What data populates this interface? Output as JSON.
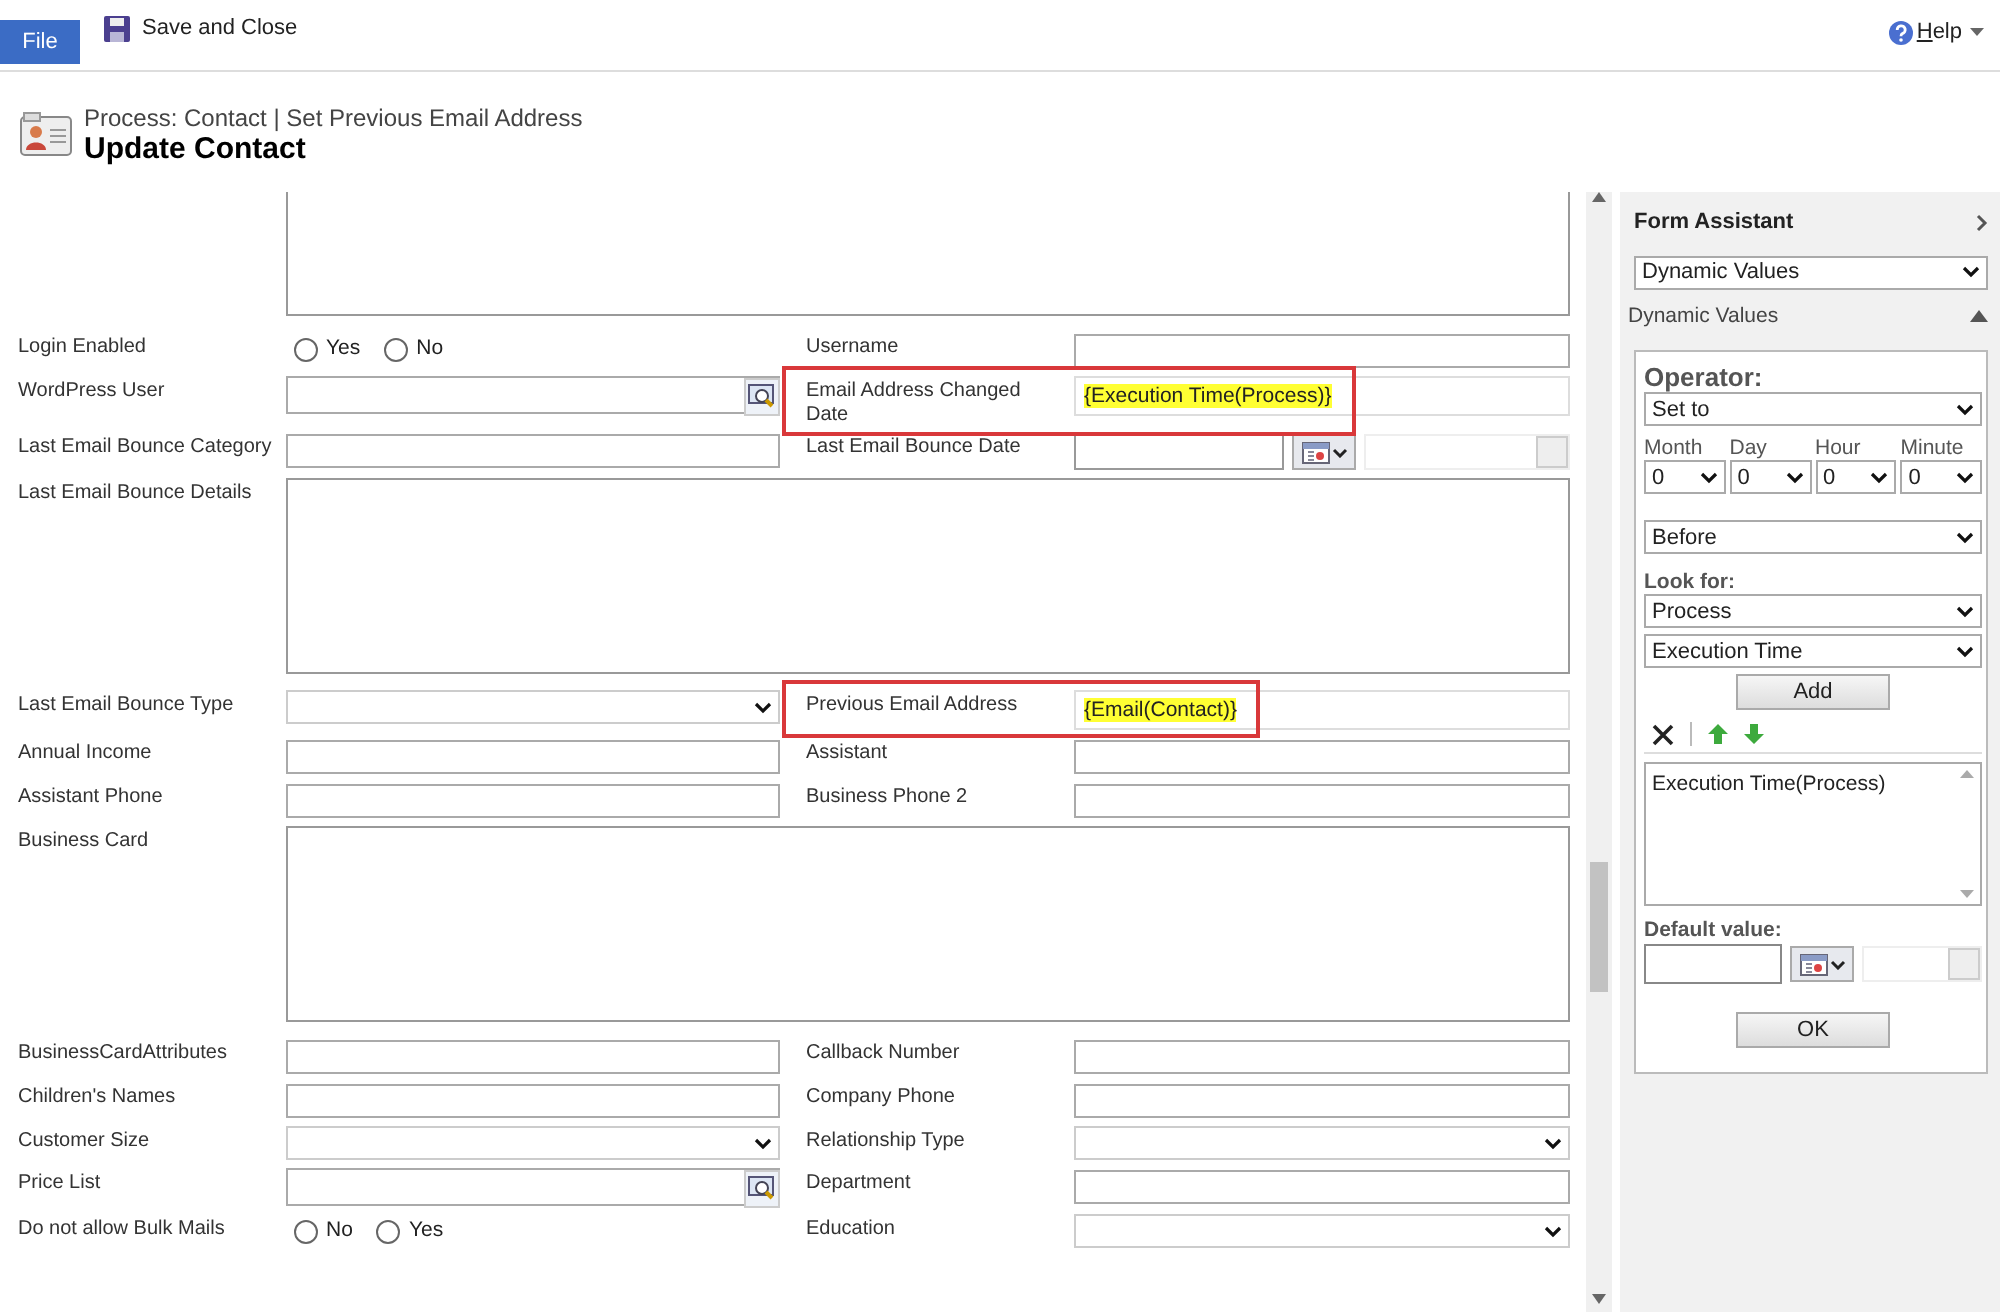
{
  "ribbon": {
    "file_tab": "File",
    "save_button": "Save and Close",
    "help": "Help"
  },
  "header": {
    "breadcrumb": "Process: Contact | Set Previous Email Address",
    "title": "Update Contact"
  },
  "form": {
    "rows": [
      {
        "kind": "textarea",
        "cut_top": true
      },
      {
        "kind": "pair",
        "left": {
          "label": "Login Enabled",
          "kind": "radio",
          "options": [
            {
              "label": "Yes",
              "selected": false
            },
            {
              "label": "No",
              "selected": false
            }
          ]
        },
        "right": {
          "label": "Username",
          "kind": "text"
        }
      },
      {
        "kind": "pair",
        "left": {
          "label": "WordPress User",
          "kind": "lookup"
        },
        "right": {
          "label": "Email Address Changed Date",
          "kind": "dynamic",
          "value": "{Execution Time(Process)}",
          "highlighted": true
        }
      },
      {
        "kind": "pair",
        "left": {
          "label": "Last Email Bounce Category",
          "kind": "text"
        },
        "right": {
          "label": "Last Email Bounce Date",
          "kind": "date"
        }
      },
      {
        "kind": "textarea",
        "label": "Last Email Bounce Details"
      },
      {
        "kind": "pair",
        "left": {
          "label": "Last Email Bounce Type",
          "kind": "select"
        },
        "right": {
          "label": "Previous Email Address",
          "kind": "dynamic",
          "value": "{Email(Contact)}",
          "highlighted": true
        }
      },
      {
        "kind": "pair",
        "left": {
          "label": "Annual Income",
          "kind": "text"
        },
        "right": {
          "label": "Assistant",
          "kind": "text"
        }
      },
      {
        "kind": "pair",
        "left": {
          "label": "Assistant Phone",
          "kind": "text"
        },
        "right": {
          "label": "Business Phone 2",
          "kind": "text"
        }
      },
      {
        "kind": "textarea",
        "label": "Business Card"
      },
      {
        "kind": "pair",
        "left": {
          "label": "BusinessCardAttributes",
          "kind": "text"
        },
        "right": {
          "label": "Callback Number",
          "kind": "text"
        }
      },
      {
        "kind": "pair",
        "left": {
          "label": "Children's Names",
          "kind": "text"
        },
        "right": {
          "label": "Company Phone",
          "kind": "text"
        }
      },
      {
        "kind": "pair",
        "left": {
          "label": "Customer Size",
          "kind": "select"
        },
        "right": {
          "label": "Relationship Type",
          "kind": "select"
        }
      },
      {
        "kind": "pair",
        "left": {
          "label": "Price List",
          "kind": "lookup"
        },
        "right": {
          "label": "Department",
          "kind": "text"
        }
      },
      {
        "kind": "pair",
        "left": {
          "label": "Do not allow Bulk Mails",
          "kind": "radio",
          "options": [
            {
              "label": "No",
              "selected": false
            },
            {
              "label": "Yes",
              "selected": false
            }
          ]
        },
        "right": {
          "label": "Education",
          "kind": "select"
        }
      }
    ]
  },
  "form_assistant": {
    "title": "Form Assistant",
    "mode_select": "Dynamic Values",
    "section": "Dynamic Values",
    "section_expanded": true,
    "operator_label": "Operator:",
    "operator": "Set to",
    "offsets": [
      {
        "label": "Month",
        "value": "0"
      },
      {
        "label": "Day",
        "value": "0"
      },
      {
        "label": "Hour",
        "value": "0"
      },
      {
        "label": "Minute",
        "value": "0"
      }
    ],
    "direction": "Before",
    "look_for_label": "Look for:",
    "look_for_entity": "Process",
    "look_for_field": "Execution Time",
    "add_button": "Add",
    "values": [
      "Execution Time(Process)"
    ],
    "default_label": "Default value:",
    "ok_button": "OK"
  }
}
